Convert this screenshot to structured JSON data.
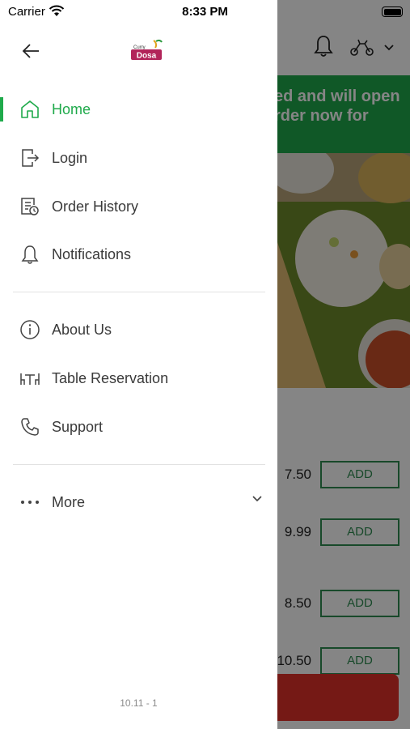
{
  "status_bar": {
    "carrier": "Carrier",
    "time": "8:33 PM"
  },
  "background": {
    "banner_line1": "ed and will open",
    "banner_line2": "rder now for",
    "items": [
      {
        "price": "7.50",
        "button": "ADD"
      },
      {
        "price": "9.99",
        "button": "ADD"
      },
      {
        "price": "8.50",
        "button": "ADD"
      },
      {
        "price": "10.50",
        "button": "ADD"
      }
    ]
  },
  "drawer": {
    "logo_text": {
      "top": "Curry",
      "main": "Dosa"
    },
    "menu": [
      {
        "label": "Home",
        "icon": "home-icon",
        "active": true
      },
      {
        "label": "Login",
        "icon": "login-icon"
      },
      {
        "label": "Order History",
        "icon": "order-history-icon"
      },
      {
        "label": "Notifications",
        "icon": "bell-icon"
      },
      {
        "label": "About Us",
        "icon": "info-icon"
      },
      {
        "label": "Table Reservation",
        "icon": "table-icon"
      },
      {
        "label": "Support",
        "icon": "phone-icon"
      },
      {
        "label": "More",
        "icon": "more-dots-icon"
      }
    ],
    "version": "10.11 - 1"
  },
  "colors": {
    "accent": "#1faa4b",
    "checkout": "#e0302a"
  }
}
